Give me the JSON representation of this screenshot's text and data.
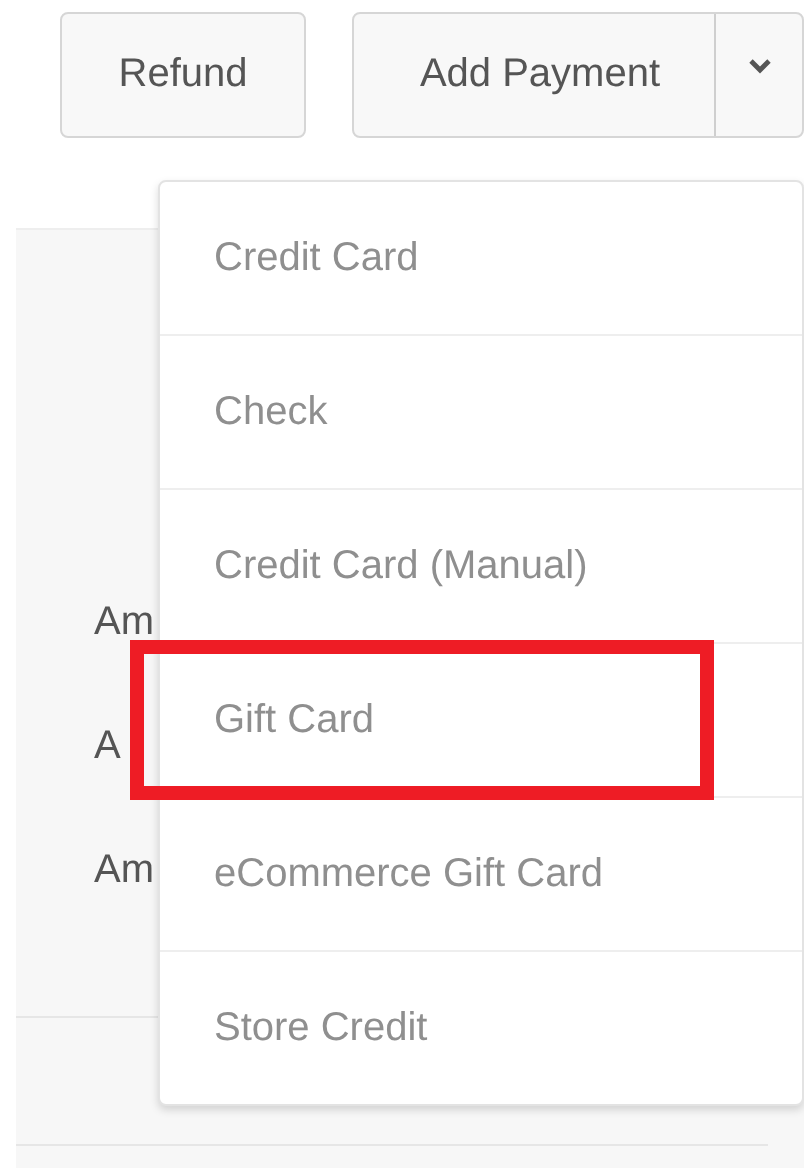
{
  "actions": {
    "refund": "Refund",
    "add_payment": "Add Payment"
  },
  "background_rows": [
    "Am",
    "A",
    "Am"
  ],
  "payment_menu": [
    {
      "label": "Credit Card",
      "highlighted": false
    },
    {
      "label": "Check",
      "highlighted": false
    },
    {
      "label": "Credit Card (Manual)",
      "highlighted": false
    },
    {
      "label": "Gift Card",
      "highlighted": true
    },
    {
      "label": "eCommerce Gift Card",
      "highlighted": false
    },
    {
      "label": "Store Credit",
      "highlighted": false
    }
  ]
}
